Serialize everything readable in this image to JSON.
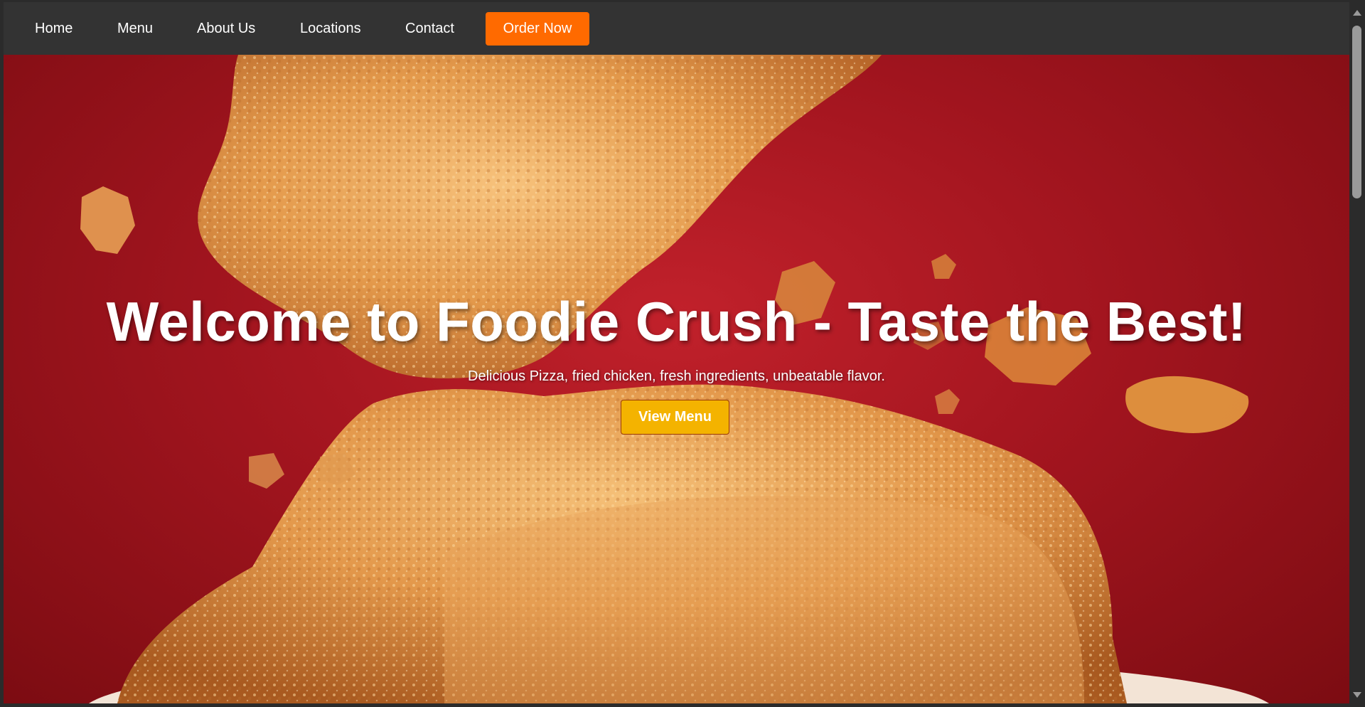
{
  "nav": {
    "items": [
      {
        "label": "Home"
      },
      {
        "label": "Menu"
      },
      {
        "label": "About Us"
      },
      {
        "label": "Locations"
      },
      {
        "label": "Contact"
      }
    ],
    "order_label": "Order Now"
  },
  "hero": {
    "title": "Welcome to Foodie Crush - Taste the Best!",
    "subtitle": "Delicious Pizza, fried chicken, fresh ingredients, unbeatable flavor.",
    "cta_label": "View Menu",
    "image": "fried-chicken-hero-image"
  },
  "colors": {
    "nav_bg": "#333333",
    "accent_order": "#ff6a00",
    "accent_cta": "#f4b300",
    "hero_bg": "#a3151f"
  }
}
